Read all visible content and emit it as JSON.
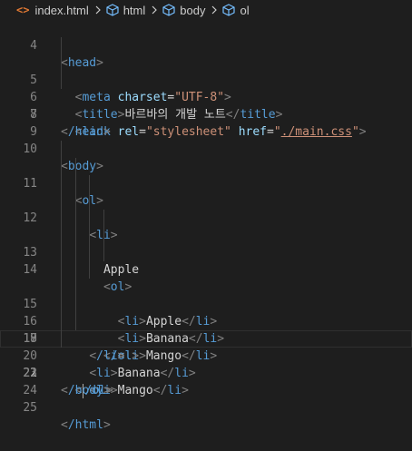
{
  "breadcrumb": {
    "file": "index.html",
    "path": [
      "html",
      "body",
      "ol"
    ]
  },
  "code": {
    "line_numbers": [
      "4",
      "5",
      "6",
      "7",
      "8",
      "9",
      "10",
      "11",
      "12",
      "13",
      "14",
      "15",
      "16",
      "17",
      "18",
      "19",
      "20",
      "21",
      "22",
      "23",
      "24",
      "25"
    ],
    "l4_tag": "head",
    "l5_tag": "meta",
    "l5_attr": "charset",
    "l5_val": "\"UTF-8\"",
    "l6_tag": "title",
    "l6_text": "바르바의 개발 노트",
    "l7_tag": "link",
    "l7_attr1": "rel",
    "l7_val1": "\"stylesheet\"",
    "l7_attr2": "href",
    "l7_val2": "./main.css",
    "l8_tag": "/head",
    "l10_tag": "body",
    "l11_tag": "ol",
    "l12_tag": "li",
    "l13_text": "Apple",
    "l14_tag": "ol",
    "l15_tag": "li",
    "l15_text": "Apple",
    "l16_tag": "li",
    "l16_text": "Banana",
    "l17_tag": "li",
    "l17_text": "Mango",
    "l18_tag": "/ol",
    "l19_tag": "/li",
    "l20_tag": "li",
    "l20_text": "Banana",
    "l21_tag": "li",
    "l21_text": "Mango",
    "l22_tag": "/ol",
    "l23_tag": "/body",
    "l25_tag": "/html"
  }
}
